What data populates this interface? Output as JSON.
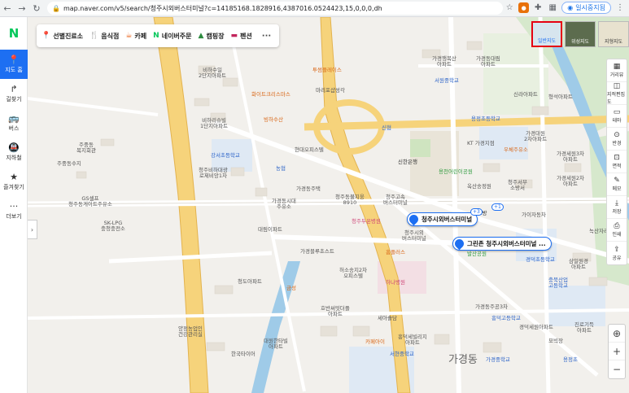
{
  "browser": {
    "url": "map.naver.com/v5/search/청주시외버스터미널?c=14185168.1828916,4387016.0524423,15,0,0,0,dh",
    "paused_label": "일시중지됨"
  },
  "leftnav": {
    "logo": "N",
    "items": [
      {
        "icon": "📍",
        "label": "지도 홈"
      },
      {
        "icon": "↱",
        "label": "길찾기"
      },
      {
        "icon": "🚌",
        "label": "버스"
      },
      {
        "icon": "🚇",
        "label": "지하철"
      },
      {
        "icon": "★",
        "label": "즐겨찾기"
      },
      {
        "icon": "···",
        "label": "더보기"
      }
    ]
  },
  "chips": [
    {
      "icon": "📍",
      "label": "선별진료소",
      "color": "#e23b3b"
    },
    {
      "icon": "🍴",
      "label": "음식점",
      "color": "#f08c00"
    },
    {
      "icon": "☕",
      "label": "카페",
      "color": "#e8590c"
    },
    {
      "icon": "N",
      "label": "네이버주문",
      "color": "#03c75a"
    },
    {
      "icon": "▲",
      "label": "캠핑장",
      "color": "#2b8a3e"
    },
    {
      "icon": "▬",
      "label": "펜션",
      "color": "#c2255c"
    }
  ],
  "chips_more": "···",
  "maptypes": [
    {
      "label": "일반지도",
      "selected": true
    },
    {
      "label": "위성지도",
      "selected": false
    },
    {
      "label": "지형지도",
      "selected": false
    }
  ],
  "righttools": [
    {
      "icon": "▦",
      "label": "거리뷰"
    },
    {
      "icon": "◫",
      "label": "지적편집도"
    },
    {
      "icon": "▭",
      "label": "테마"
    },
    {
      "icon": "⊙",
      "label": "반경"
    },
    {
      "icon": "⊡",
      "label": "면적"
    },
    {
      "icon": "✎",
      "label": "메모"
    },
    {
      "icon": "⤓",
      "label": "저장"
    },
    {
      "icon": "⎙",
      "label": "인쇄"
    },
    {
      "icon": "⇪",
      "label": "공유"
    }
  ],
  "zoom": {
    "locate": "⊕",
    "in": "+",
    "out": "−"
  },
  "markers": [
    {
      "label": "청주시외버스터미널",
      "badge": "+3"
    },
    {
      "label": "그린존 청주시외버스터미널 ...",
      "badge": "+1"
    }
  ],
  "labels": {
    "area": "가경동",
    "l1": "비하수일\n2단지아파트",
    "l2": "비하리슈빌\n1단지아파트",
    "l3": "주중동\n복지회관",
    "l4": "주중동수지",
    "l5": "청주비하대광\n로제비앙1차",
    "l6": "GS셀프\n청주동게이트주유소",
    "l7": "SK-LPG\n충청충전소",
    "l8": "강서초등학교",
    "l9": "농협",
    "l10": "현대오피스텔",
    "l11": "화이트크리스마스",
    "l12": "마리포샵성각",
    "l13": "투썸플레이스",
    "l14": "빙하수산",
    "l15": "신협",
    "l16": "가경동주택",
    "l17": "가경동시대\n주유소",
    "l18": "청주동불지웅\n8910",
    "l19": "청주고속\n버스터미널",
    "l20": "청주두온병원",
    "l21": "청주시외\n버스터미널",
    "l22": "홈플러스",
    "l23": "신한은행",
    "l24": "용천어린이공원",
    "l25": "KT 가경지점",
    "l26": "용정초등학교",
    "l27": "서원중학교",
    "l28": "가경행복산\n아파트",
    "l29": "가경동대림\n아파트",
    "l30": "신라아파트",
    "l31": "형석아파트",
    "l32": "가경대원\n2차아파트",
    "l33": "우체주유소",
    "l34": "가경세원3차\n아파트",
    "l35": "가경세원2차\n아파트",
    "l36": "옥산송정원",
    "l37": "청주서부\n소방서",
    "l38": "가이자동차",
    "l39": "PC방",
    "l40": "발산공원",
    "l41": "경덕초등학교",
    "l42": "가경블루초스트",
    "l43": "허소송지2차\n오피스텔",
    "l44": "하나병원",
    "l45": "청도아파트",
    "l46": "금성",
    "l47": "대림이파트",
    "l48": "호반써밋더플\n아파트",
    "l49": "세아솔담",
    "l50": "흥덕세빌리지\n아파트",
    "l51": "카페아이",
    "l52": "흥덕고등학교",
    "l53": "가경동주공3차",
    "l54": "양정농업인\n건강관리실",
    "l55": "한국타이어",
    "l56": "대원한타빌\n아파트",
    "l57": "서현중학교",
    "l58": "가경중학교",
    "l59": "충북산업\n고등학교",
    "l60": "진로기득\n아파트",
    "l61": "경덕세원아파트",
    "l62": "모빅장",
    "l63": "삼일원경\n아파트",
    "l64": "용정초",
    "l65": "녹산자리"
  }
}
